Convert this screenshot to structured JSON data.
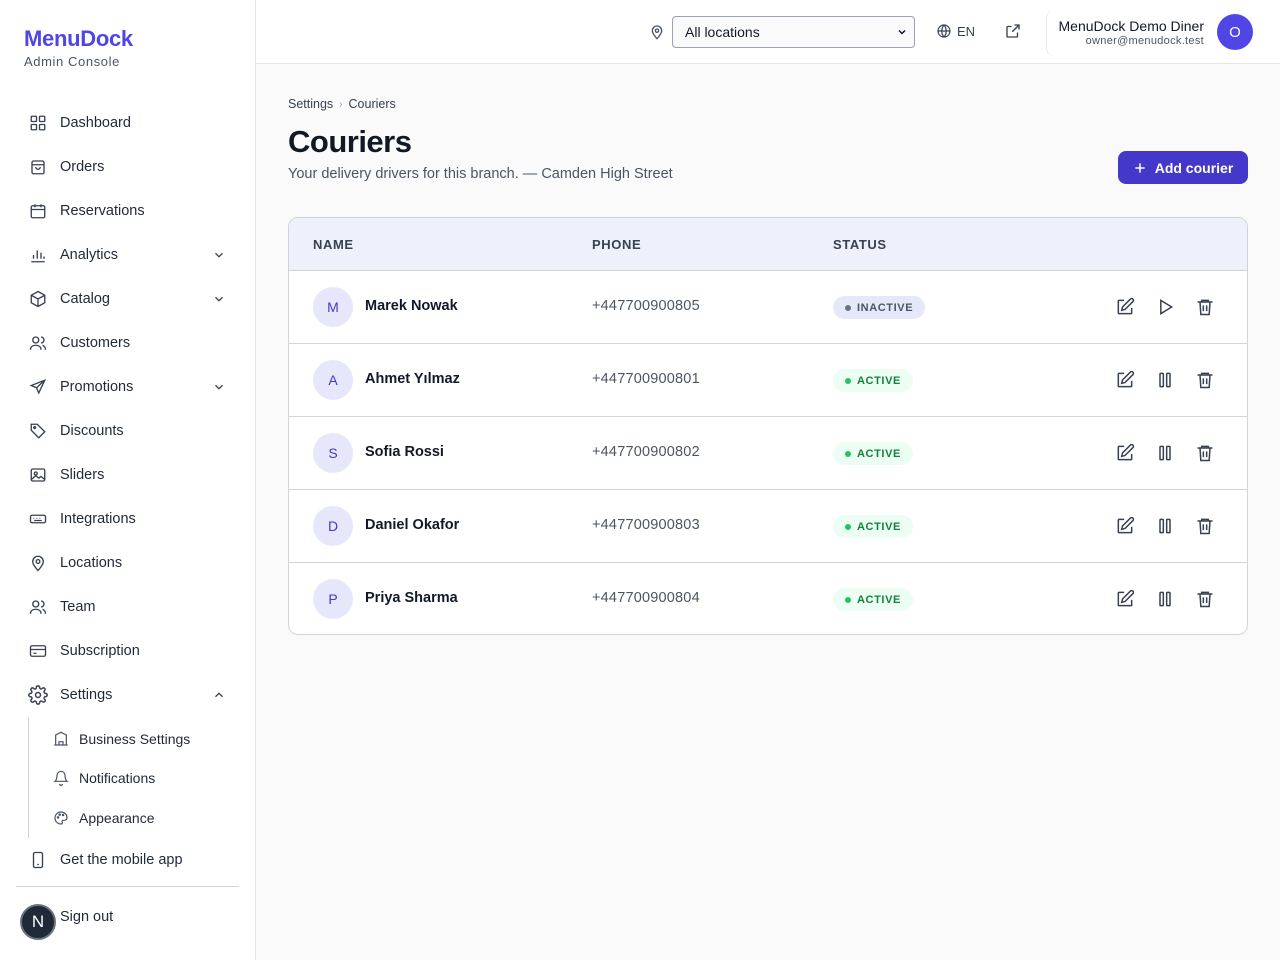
{
  "brand": {
    "name": "MenuDock",
    "subtitle": "Admin Console"
  },
  "sidebar": {
    "items": [
      {
        "label": "Dashboard",
        "icon": "dashboard-icon"
      },
      {
        "label": "Orders",
        "icon": "shopping-bag-icon"
      },
      {
        "label": "Reservations",
        "icon": "calendar-icon"
      },
      {
        "label": "Analytics",
        "icon": "bar-chart-icon",
        "expandable": true
      },
      {
        "label": "Catalog",
        "icon": "box-icon",
        "expandable": true
      },
      {
        "label": "Customers",
        "icon": "users-icon"
      },
      {
        "label": "Promotions",
        "icon": "send-icon",
        "expandable": true
      },
      {
        "label": "Discounts",
        "icon": "tag-icon"
      },
      {
        "label": "Sliders",
        "icon": "image-icon"
      },
      {
        "label": "Integrations",
        "icon": "keyboard-icon"
      },
      {
        "label": "Locations",
        "icon": "map-pin-icon"
      },
      {
        "label": "Team",
        "icon": "team-icon"
      },
      {
        "label": "Subscription",
        "icon": "credit-card-icon"
      },
      {
        "label": "Settings",
        "icon": "gear-icon",
        "expanded": true
      }
    ],
    "settings_sub": [
      {
        "label": "Business Settings",
        "icon": "building-icon"
      },
      {
        "label": "Notifications",
        "icon": "bell-icon"
      },
      {
        "label": "Appearance",
        "icon": "palette-icon"
      }
    ],
    "mobile_app": "Get the mobile app",
    "sign_out": "Sign out",
    "user_initial": "N"
  },
  "header": {
    "location_select": "All locations",
    "language": "EN",
    "user_name": "MenuDock Demo Diner",
    "user_email": "owner@menudock.test",
    "user_initial": "O"
  },
  "breadcrumb": {
    "parent": "Settings",
    "current": "Couriers"
  },
  "page": {
    "title": "Couriers",
    "subtitle": "Your delivery drivers for this branch. — Camden High Street",
    "add_button": "Add courier"
  },
  "table": {
    "columns": [
      "NAME",
      "PHONE",
      "STATUS"
    ],
    "rows": [
      {
        "initial": "M",
        "name": "Marek Nowak",
        "phone": "+447700900805",
        "status": "INACTIVE"
      },
      {
        "initial": "A",
        "name": "Ahmet Yılmaz",
        "phone": "+447700900801",
        "status": "ACTIVE"
      },
      {
        "initial": "S",
        "name": "Sofia Rossi",
        "phone": "+447700900802",
        "status": "ACTIVE"
      },
      {
        "initial": "D",
        "name": "Daniel Okafor",
        "phone": "+447700900803",
        "status": "ACTIVE"
      },
      {
        "initial": "P",
        "name": "Priya Sharma",
        "phone": "+447700900804",
        "status": "ACTIVE"
      }
    ]
  },
  "colors": {
    "accent": "#4f46e5",
    "button": "#4338ca",
    "active": "#15803d",
    "inactive": "#4b5563"
  }
}
